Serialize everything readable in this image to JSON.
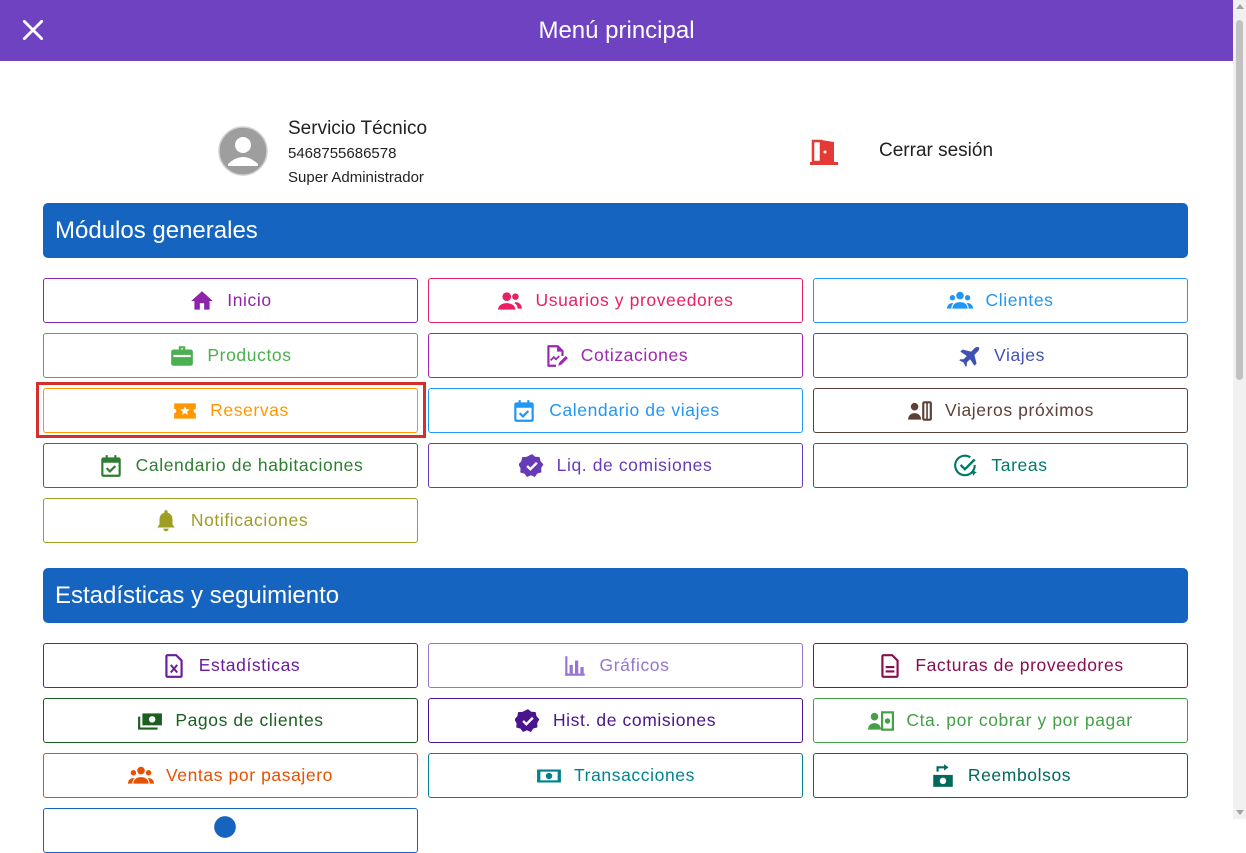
{
  "header": {
    "title": "Menú principal"
  },
  "user": {
    "name": "Servicio Técnico",
    "phone": "5468755686578",
    "role": "Super Administrador"
  },
  "logout": {
    "label": "Cerrar sesión"
  },
  "sections": {
    "general": {
      "title": "Módulos generales",
      "items": [
        {
          "label": "Inicio",
          "icon": "home-icon",
          "color": "#8e24aa"
        },
        {
          "label": "Usuarios y proveedores",
          "icon": "users-icon",
          "color": "#e91e63"
        },
        {
          "label": "Clientes",
          "icon": "group-icon",
          "color": "#2196f3"
        },
        {
          "label": "Productos",
          "icon": "briefcase-icon",
          "color": "#4caf50"
        },
        {
          "label": "Cotizaciones",
          "icon": "document-edit-icon",
          "color": "#9c27b0"
        },
        {
          "label": "Viajes",
          "icon": "airplane-icon",
          "color": "#3f51b5"
        },
        {
          "label": "Reservas",
          "icon": "ticket-star-icon",
          "color": "#ff9800"
        },
        {
          "label": "Calendario de viajes",
          "icon": "calendar-check-icon",
          "color": "#2196f3"
        },
        {
          "label": "Viajeros próximos",
          "icon": "travelers-icon",
          "color": "#5d4037"
        },
        {
          "label": "Calendario de habitaciones",
          "icon": "calendar-check-icon",
          "color": "#2e7d32"
        },
        {
          "label": "Liq. de comisiones",
          "icon": "verified-icon",
          "color": "#673ab7"
        },
        {
          "label": "Tareas",
          "icon": "task-check-icon",
          "color": "#00796b"
        },
        {
          "label": "Notificaciones",
          "icon": "bell-icon",
          "color": "#9e9d24"
        }
      ]
    },
    "stats": {
      "title": "Estadísticas y seguimiento",
      "items": [
        {
          "label": "Estadísticas",
          "icon": "spreadsheet-icon",
          "color": "#6a1b9a"
        },
        {
          "label": "Gráficos",
          "icon": "bar-chart-icon",
          "color": "#9575cd"
        },
        {
          "label": "Facturas de proveedores",
          "icon": "invoice-icon",
          "color": "#880e4f"
        },
        {
          "label": "Pagos de clientes",
          "icon": "cash-icon",
          "color": "#1b5e20"
        },
        {
          "label": "Hist. de comisiones",
          "icon": "verified-icon",
          "color": "#4a148c"
        },
        {
          "label": "Cta. por cobrar y por pagar",
          "icon": "account-cash-icon",
          "color": "#43a047"
        },
        {
          "label": "Ventas por pasajero",
          "icon": "group-icon",
          "color": "#e65100"
        },
        {
          "label": "Transacciones",
          "icon": "money-icon",
          "color": "#00838f"
        },
        {
          "label": "Reembolsos",
          "icon": "refund-icon",
          "color": "#00695c"
        }
      ]
    }
  }
}
